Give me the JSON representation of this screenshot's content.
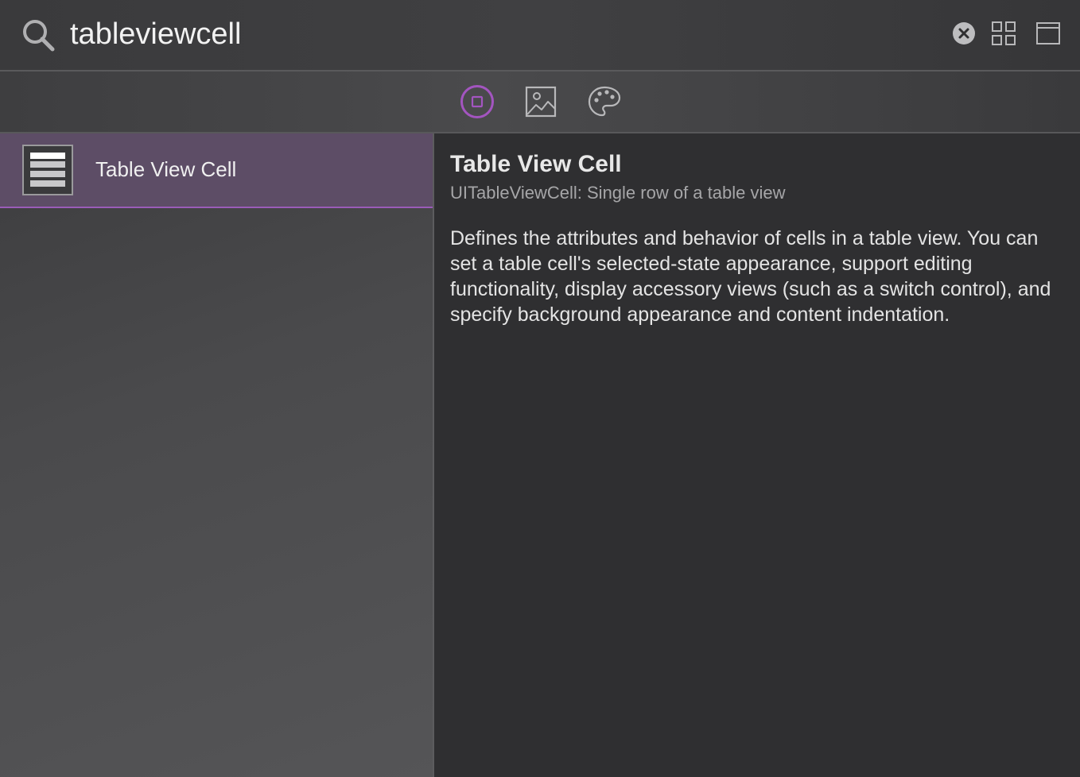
{
  "search": {
    "value": "tableviewcell",
    "icon": "search-icon",
    "clear_icon": "clear-circle-icon",
    "grid_icon": "grid-view-icon",
    "window_icon": "window-panel-icon"
  },
  "filters": [
    {
      "icon": "objects-library-icon",
      "selected": true
    },
    {
      "icon": "media-library-icon",
      "selected": false
    },
    {
      "icon": "color-palette-icon",
      "selected": false
    }
  ],
  "results": [
    {
      "label": "Table View Cell",
      "icon": "table-view-cell-icon",
      "selected": true
    }
  ],
  "detail": {
    "title": "Table View Cell",
    "subtitle": "UITableViewCell: Single row of a table view",
    "description": "Defines the attributes and behavior of cells in a table view. You can set a table cell's selected-state appearance, support editing functionality, display accessory views (such as a switch control), and specify background appearance and content indentation."
  },
  "colors": {
    "accent": "#a355c0",
    "selection_bg": "#5d4d66",
    "background": "#2f2f31"
  }
}
